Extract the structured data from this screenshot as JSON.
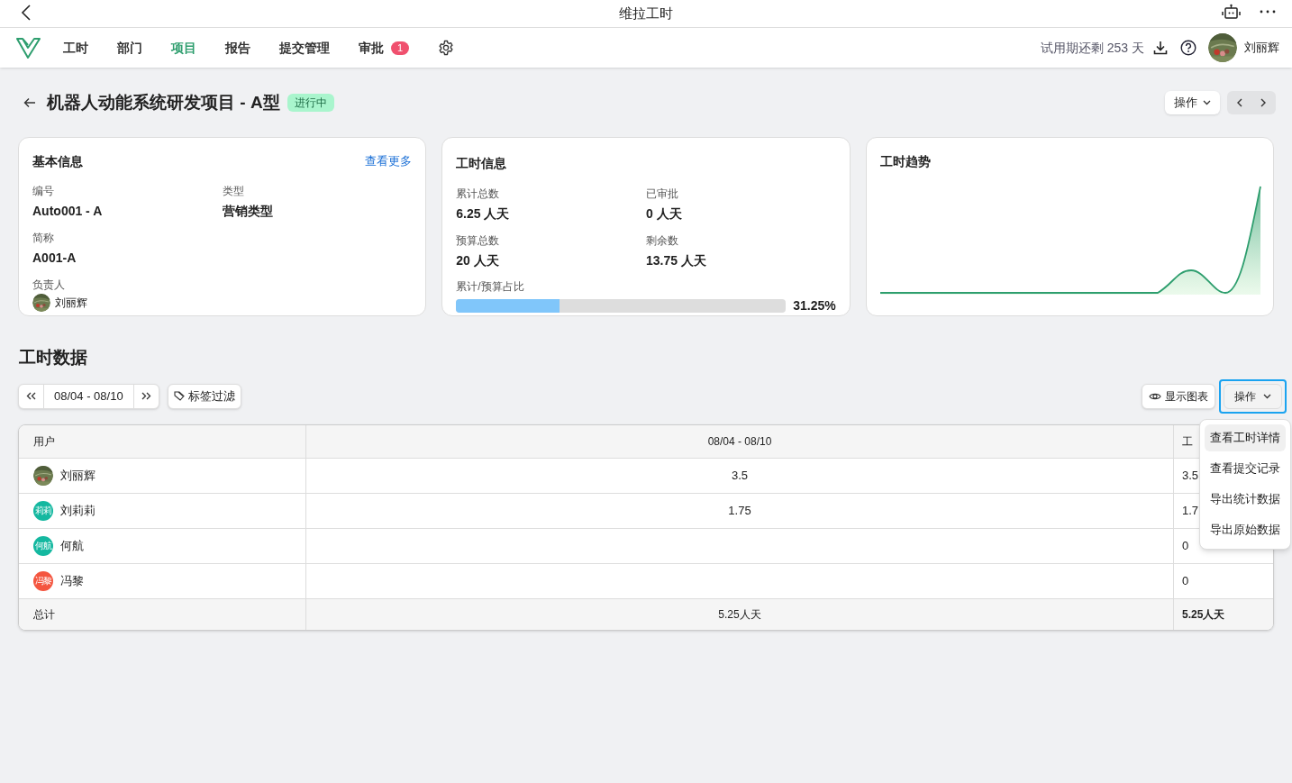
{
  "app_bar": {
    "title": "维拉工时"
  },
  "nav": {
    "items": [
      {
        "label": "工时",
        "selected": false
      },
      {
        "label": "部门",
        "selected": false
      },
      {
        "label": "项目",
        "selected": true
      },
      {
        "label": "报告",
        "selected": false
      },
      {
        "label": "提交管理",
        "selected": false
      },
      {
        "label": "审批",
        "selected": false,
        "badge": "1"
      }
    ],
    "trial": "试用期还剩 253 天",
    "user": "刘丽辉"
  },
  "project": {
    "title": "机器人动能系统研发项目 - A型",
    "status": "进行中",
    "actions": "操作"
  },
  "basic_info": {
    "title": "基本信息",
    "more": "查看更多",
    "fields": [
      {
        "label": "编号",
        "value": "Auto001 - A"
      },
      {
        "label": "类型",
        "value": "营销类型"
      },
      {
        "label": "简称",
        "value": "A001-A"
      }
    ],
    "owner_label": "负责人",
    "owner": "刘丽辉"
  },
  "hours_info": {
    "title": "工时信息",
    "fields": [
      {
        "label": "累计总数",
        "value": "6.25 人天"
      },
      {
        "label": "已审批",
        "value": "0 人天"
      },
      {
        "label": "预算总数",
        "value": "20 人天"
      },
      {
        "label": "剩余数",
        "value": "13.75 人天"
      }
    ],
    "ratio_label": "累计/预算占比",
    "level": 0.3125,
    "ratio": "31.25%"
  },
  "trend": {
    "title": "工时趋势"
  },
  "section_title": "工时数据",
  "toolbar": {
    "range": "08/04 - 08/10",
    "tag_filter": "标签过滤",
    "show_chart": "显示图表",
    "actions": "操作"
  },
  "table": {
    "columns": [
      "用户",
      "08/04 - 08/10",
      "工"
    ],
    "rows": [
      {
        "user": "刘丽辉",
        "week": "3.5",
        "column_3": "3.5"
      },
      {
        "user": "刘莉莉",
        "kind": "initials",
        "initials": "莉莉",
        "color": "#14b8a0",
        "week": "1.75",
        "column_3": "1.7"
      },
      {
        "user": "何航",
        "kind": "initials",
        "initials": "何航",
        "color": "#14b8a0",
        "column_3": "0"
      },
      {
        "user": "冯黎",
        "kind": "initials",
        "initials": "冯黎",
        "color": "#f4553f",
        "column_3": "0"
      }
    ],
    "total": {
      "label": "总计",
      "week": "5.25人天",
      "column_3": "5.25人天"
    }
  },
  "menu": {
    "items": [
      {
        "label": "查看工时详情",
        "selected": true
      },
      {
        "label": "查看提交记录",
        "selected": false
      },
      {
        "label": "导出统计数据",
        "selected": false
      },
      {
        "label": "导出原始数据",
        "selected": false
      }
    ]
  }
}
